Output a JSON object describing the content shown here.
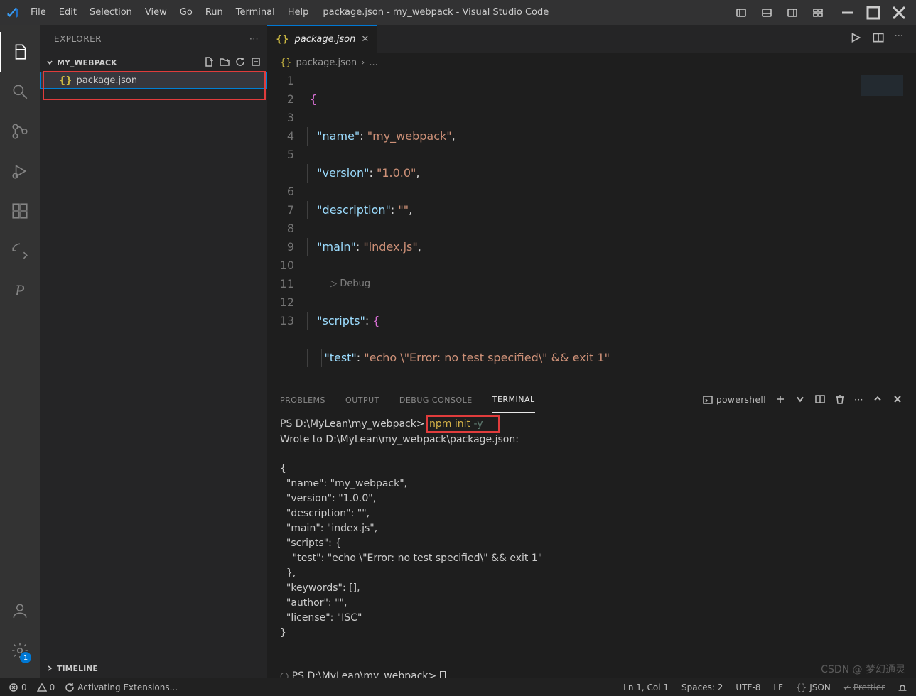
{
  "title": "package.json - my_webpack - Visual Studio Code",
  "menus": [
    "File",
    "Edit",
    "Selection",
    "View",
    "Go",
    "Run",
    "Terminal",
    "Help"
  ],
  "sidebar": {
    "header": "EXPLORER",
    "section": "MY_WEBPACK",
    "files": [
      {
        "name": "package.json"
      }
    ],
    "timeline": "TIMELINE"
  },
  "tab": {
    "label": "package.json"
  },
  "breadcrumb": {
    "file": "package.json",
    "sep": "›",
    "dots": "..."
  },
  "code_lines": [
    "1",
    "2",
    "3",
    "4",
    "5",
    "6",
    "7",
    "8",
    "9",
    "10",
    "11",
    "12",
    "13"
  ],
  "code": {
    "l1": "{",
    "k_name": "\"name\"",
    "v_name": "\"my_webpack\"",
    "k_version": "\"version\"",
    "v_version": "\"1.0.0\"",
    "k_desc": "\"description\"",
    "v_desc": "\"\"",
    "k_main": "\"main\"",
    "v_main": "\"index.js\"",
    "debug": "Debug",
    "k_scripts": "\"scripts\"",
    "k_test": "\"test\"",
    "v_test": "\"echo \\\"Error: no test specified\\\" && exit 1\"",
    "k_keywords": "\"keywords\"",
    "k_author": "\"author\"",
    "v_author": "\"\"",
    "k_license": "\"license\"",
    "v_license": "\"ISC\"",
    "l12": "}"
  },
  "panel_tabs": {
    "problems": "PROBLEMS",
    "output": "OUTPUT",
    "debug": "DEBUG CONSOLE",
    "terminal": "TERMINAL"
  },
  "terminal": {
    "shell": "powershell",
    "prompt1": "PS D:\\MyLean\\my_webpack> ",
    "cmd": "npm init",
    "flag": " -y",
    "line2": "Wrote to D:\\MyLean\\my_webpack\\package.json:",
    "output": "{\n  \"name\": \"my_webpack\",\n  \"version\": \"1.0.0\",\n  \"description\": \"\",\n  \"main\": \"index.js\",\n  \"scripts\": {\n    \"test\": \"echo \\\"Error: no test specified\\\" && exit 1\"\n  },\n  \"keywords\": [],\n  \"author\": \"\",\n  \"license\": \"ISC\"\n}",
    "prompt2": "PS D:\\MyLean\\my_webpack> "
  },
  "status": {
    "errors": "0",
    "warnings": "0",
    "activating": "Activating Extensions...",
    "ln": "Ln 1, Col 1",
    "spaces": "Spaces: 2",
    "enc": "UTF-8",
    "eol": "LF",
    "lang": "JSON",
    "prettier": "Prettier",
    "bell": ""
  },
  "settings_badge": "1",
  "watermark": "CSDN @ 梦幻通灵"
}
